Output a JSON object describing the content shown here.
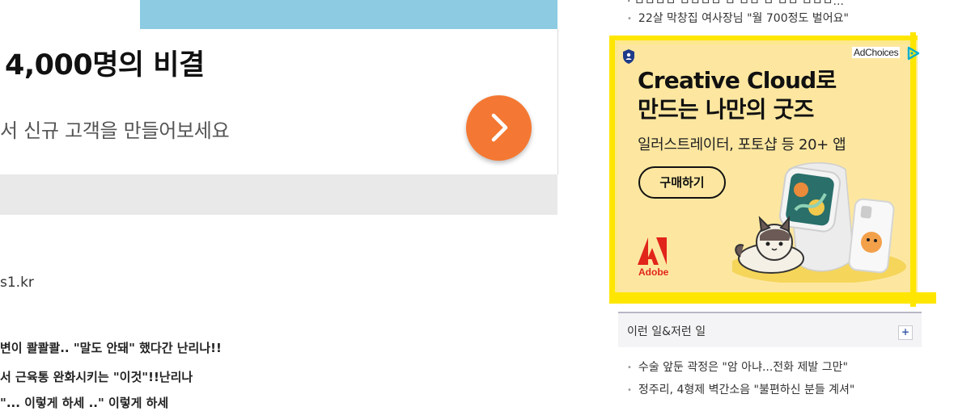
{
  "main": {
    "headline": "4,000명의 비결",
    "subline": "서 신규 고객을 만들어보세요",
    "go_button_icon": "chevron-right-icon",
    "source": "s1.kr",
    "news": [
      "변이 콸콸콸.. \"말도 안돼\" 했다간 난리나!!",
      "서 근육통 완화시키는 \"이것\"!!난리나",
      "\"... 이렇게 하세 ..\" 이렇게 하세"
    ],
    "colors": {
      "top_band": "#8ccbe2",
      "go_button": "#f47833",
      "bottom_band": "#e9e9e9"
    }
  },
  "sidebar": {
    "cut_top_text": "· ㅁㅁㅁㅁ ㅁㅁㅁㅁ ㅁ ㅁㅁ ㅁ ㅁㅁ ㅁㅁㅁ...",
    "top_item": "22살 막창집 여사장님 \"월 700정도 벌어요\"",
    "ad": {
      "adchoices": "AdChoices",
      "title_line1": "Creative Cloud로",
      "title_line2": "만드는 나만의 굿즈",
      "subtitle": "일러스트레이터, 포토샵 등 20+ 앱",
      "button": "구매하기",
      "brand": "Adobe",
      "colors": {
        "background": "#fde7a0",
        "highlight_border": "#ffe600",
        "brand_red": "#e1251b"
      }
    },
    "section": {
      "title": "이런 일&저런 일",
      "expand": "+",
      "items": [
        "수술 앞둔 곽정은 \"암 아냐...전화 제발 그만\"",
        "정주리, 4형제 벽간소음 \"불편하신 분들 계셔\""
      ]
    }
  }
}
